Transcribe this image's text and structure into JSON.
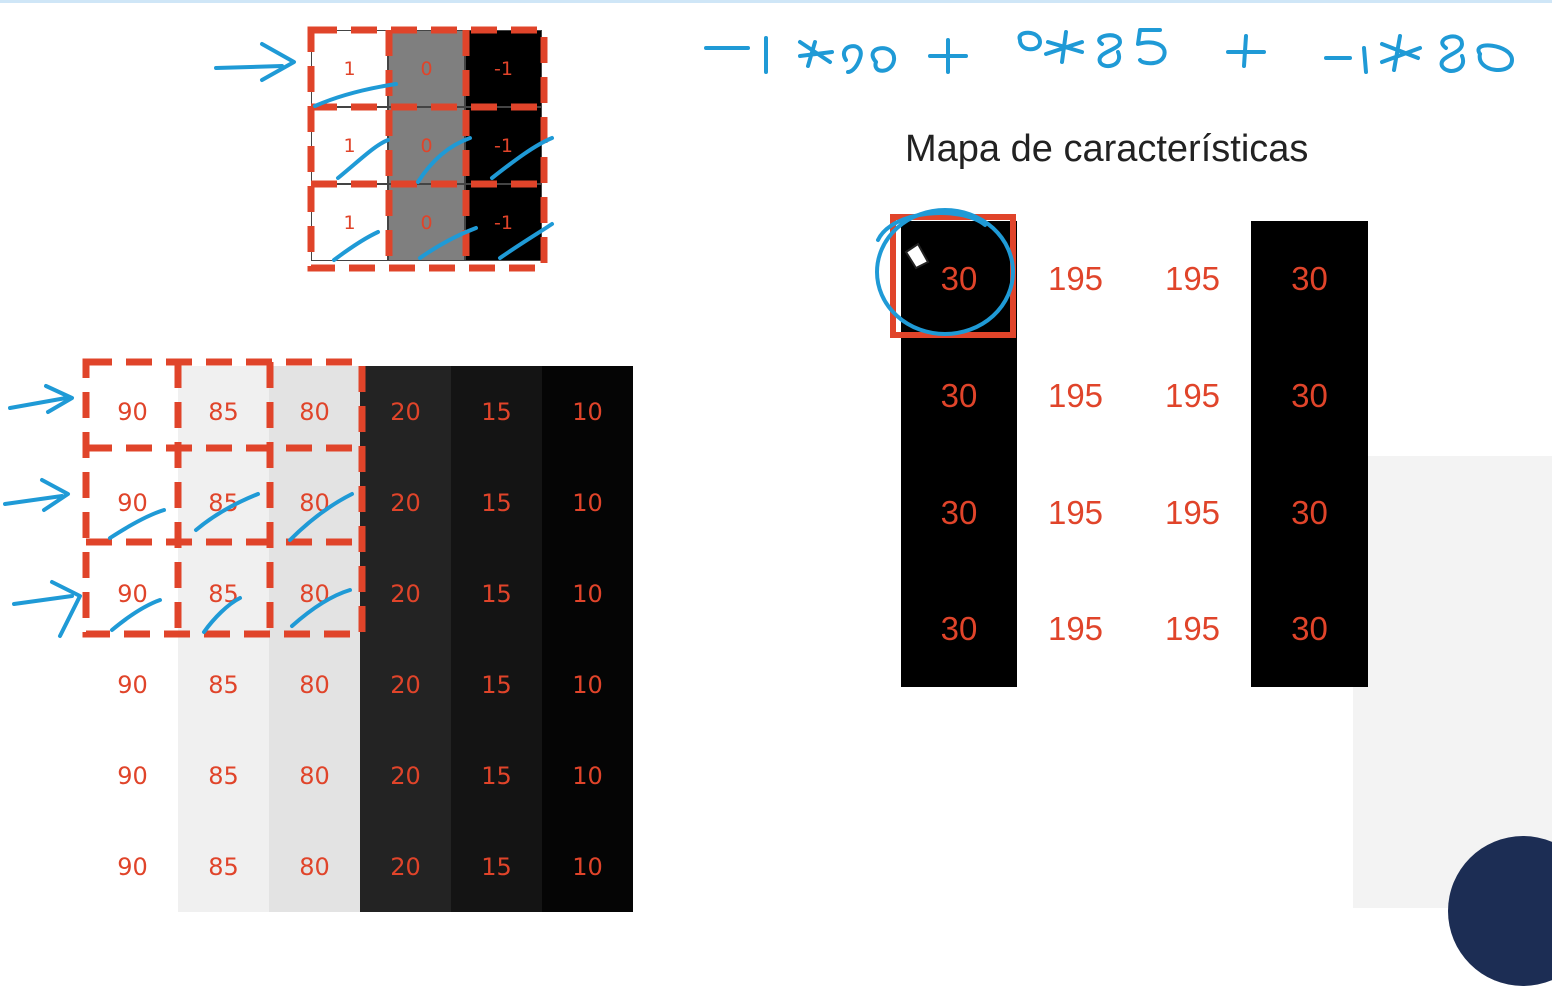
{
  "kernel": {
    "rows": [
      [
        "1",
        "0",
        "-1"
      ],
      [
        "1",
        "0",
        "-1"
      ],
      [
        "1",
        "0",
        "-1"
      ]
    ],
    "column_colors": [
      "#ffffff",
      "#7f7f7f",
      "#000000"
    ]
  },
  "input_image": {
    "rows": [
      [
        "90",
        "85",
        "80",
        "20",
        "15",
        "10"
      ],
      [
        "90",
        "85",
        "80",
        "20",
        "15",
        "10"
      ],
      [
        "90",
        "85",
        "80",
        "20",
        "15",
        "10"
      ],
      [
        "90",
        "85",
        "80",
        "20",
        "15",
        "10"
      ],
      [
        "90",
        "85",
        "80",
        "20",
        "15",
        "10"
      ],
      [
        "90",
        "85",
        "80",
        "20",
        "15",
        "10"
      ]
    ],
    "column_colors": [
      "#ffffff",
      "#f0f0f0",
      "#e3e3e3",
      "#232323",
      "#141414",
      "#050505"
    ]
  },
  "feature_map": {
    "title": "Mapa de características",
    "rows": [
      [
        "30",
        "195",
        "195",
        "30"
      ],
      [
        "30",
        "195",
        "195",
        "30"
      ],
      [
        "30",
        "195",
        "195",
        "30"
      ],
      [
        "30",
        "195",
        "195",
        "30"
      ]
    ],
    "column_colors": [
      "#000000",
      "#ffffff",
      "#ffffff",
      "#000000"
    ]
  },
  "handwritten_formula": "−1∗90 + 0∗85 + −1∗80",
  "colors": {
    "value_text": "#e0442a",
    "dashed_highlight": "#e0442a",
    "annotation_ink": "#1f9ad6"
  }
}
